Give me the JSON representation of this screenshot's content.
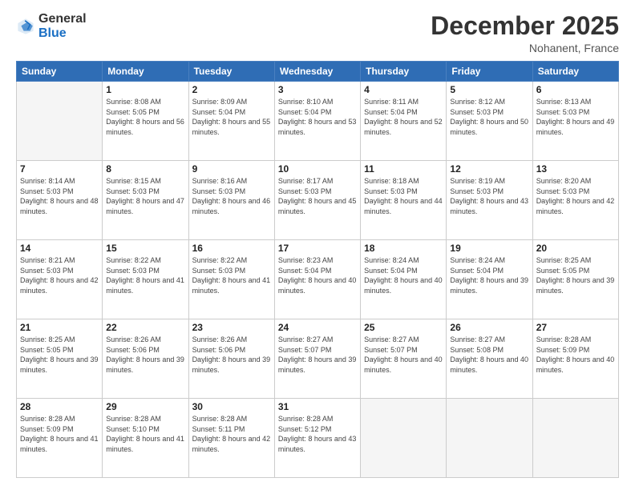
{
  "header": {
    "logo_general": "General",
    "logo_blue": "Blue",
    "month_title": "December 2025",
    "location": "Nohanent, France"
  },
  "days_of_week": [
    "Sunday",
    "Monday",
    "Tuesday",
    "Wednesday",
    "Thursday",
    "Friday",
    "Saturday"
  ],
  "weeks": [
    [
      {
        "day": "",
        "empty": true
      },
      {
        "day": "1",
        "sunrise": "Sunrise: 8:08 AM",
        "sunset": "Sunset: 5:05 PM",
        "daylight": "Daylight: 8 hours and 56 minutes."
      },
      {
        "day": "2",
        "sunrise": "Sunrise: 8:09 AM",
        "sunset": "Sunset: 5:04 PM",
        "daylight": "Daylight: 8 hours and 55 minutes."
      },
      {
        "day": "3",
        "sunrise": "Sunrise: 8:10 AM",
        "sunset": "Sunset: 5:04 PM",
        "daylight": "Daylight: 8 hours and 53 minutes."
      },
      {
        "day": "4",
        "sunrise": "Sunrise: 8:11 AM",
        "sunset": "Sunset: 5:04 PM",
        "daylight": "Daylight: 8 hours and 52 minutes."
      },
      {
        "day": "5",
        "sunrise": "Sunrise: 8:12 AM",
        "sunset": "Sunset: 5:03 PM",
        "daylight": "Daylight: 8 hours and 50 minutes."
      },
      {
        "day": "6",
        "sunrise": "Sunrise: 8:13 AM",
        "sunset": "Sunset: 5:03 PM",
        "daylight": "Daylight: 8 hours and 49 minutes."
      }
    ],
    [
      {
        "day": "7",
        "sunrise": "Sunrise: 8:14 AM",
        "sunset": "Sunset: 5:03 PM",
        "daylight": "Daylight: 8 hours and 48 minutes."
      },
      {
        "day": "8",
        "sunrise": "Sunrise: 8:15 AM",
        "sunset": "Sunset: 5:03 PM",
        "daylight": "Daylight: 8 hours and 47 minutes."
      },
      {
        "day": "9",
        "sunrise": "Sunrise: 8:16 AM",
        "sunset": "Sunset: 5:03 PM",
        "daylight": "Daylight: 8 hours and 46 minutes."
      },
      {
        "day": "10",
        "sunrise": "Sunrise: 8:17 AM",
        "sunset": "Sunset: 5:03 PM",
        "daylight": "Daylight: 8 hours and 45 minutes."
      },
      {
        "day": "11",
        "sunrise": "Sunrise: 8:18 AM",
        "sunset": "Sunset: 5:03 PM",
        "daylight": "Daylight: 8 hours and 44 minutes."
      },
      {
        "day": "12",
        "sunrise": "Sunrise: 8:19 AM",
        "sunset": "Sunset: 5:03 PM",
        "daylight": "Daylight: 8 hours and 43 minutes."
      },
      {
        "day": "13",
        "sunrise": "Sunrise: 8:20 AM",
        "sunset": "Sunset: 5:03 PM",
        "daylight": "Daylight: 8 hours and 42 minutes."
      }
    ],
    [
      {
        "day": "14",
        "sunrise": "Sunrise: 8:21 AM",
        "sunset": "Sunset: 5:03 PM",
        "daylight": "Daylight: 8 hours and 42 minutes."
      },
      {
        "day": "15",
        "sunrise": "Sunrise: 8:22 AM",
        "sunset": "Sunset: 5:03 PM",
        "daylight": "Daylight: 8 hours and 41 minutes."
      },
      {
        "day": "16",
        "sunrise": "Sunrise: 8:22 AM",
        "sunset": "Sunset: 5:03 PM",
        "daylight": "Daylight: 8 hours and 41 minutes."
      },
      {
        "day": "17",
        "sunrise": "Sunrise: 8:23 AM",
        "sunset": "Sunset: 5:04 PM",
        "daylight": "Daylight: 8 hours and 40 minutes."
      },
      {
        "day": "18",
        "sunrise": "Sunrise: 8:24 AM",
        "sunset": "Sunset: 5:04 PM",
        "daylight": "Daylight: 8 hours and 40 minutes."
      },
      {
        "day": "19",
        "sunrise": "Sunrise: 8:24 AM",
        "sunset": "Sunset: 5:04 PM",
        "daylight": "Daylight: 8 hours and 39 minutes."
      },
      {
        "day": "20",
        "sunrise": "Sunrise: 8:25 AM",
        "sunset": "Sunset: 5:05 PM",
        "daylight": "Daylight: 8 hours and 39 minutes."
      }
    ],
    [
      {
        "day": "21",
        "sunrise": "Sunrise: 8:25 AM",
        "sunset": "Sunset: 5:05 PM",
        "daylight": "Daylight: 8 hours and 39 minutes."
      },
      {
        "day": "22",
        "sunrise": "Sunrise: 8:26 AM",
        "sunset": "Sunset: 5:06 PM",
        "daylight": "Daylight: 8 hours and 39 minutes."
      },
      {
        "day": "23",
        "sunrise": "Sunrise: 8:26 AM",
        "sunset": "Sunset: 5:06 PM",
        "daylight": "Daylight: 8 hours and 39 minutes."
      },
      {
        "day": "24",
        "sunrise": "Sunrise: 8:27 AM",
        "sunset": "Sunset: 5:07 PM",
        "daylight": "Daylight: 8 hours and 39 minutes."
      },
      {
        "day": "25",
        "sunrise": "Sunrise: 8:27 AM",
        "sunset": "Sunset: 5:07 PM",
        "daylight": "Daylight: 8 hours and 40 minutes."
      },
      {
        "day": "26",
        "sunrise": "Sunrise: 8:27 AM",
        "sunset": "Sunset: 5:08 PM",
        "daylight": "Daylight: 8 hours and 40 minutes."
      },
      {
        "day": "27",
        "sunrise": "Sunrise: 8:28 AM",
        "sunset": "Sunset: 5:09 PM",
        "daylight": "Daylight: 8 hours and 40 minutes."
      }
    ],
    [
      {
        "day": "28",
        "sunrise": "Sunrise: 8:28 AM",
        "sunset": "Sunset: 5:09 PM",
        "daylight": "Daylight: 8 hours and 41 minutes."
      },
      {
        "day": "29",
        "sunrise": "Sunrise: 8:28 AM",
        "sunset": "Sunset: 5:10 PM",
        "daylight": "Daylight: 8 hours and 41 minutes."
      },
      {
        "day": "30",
        "sunrise": "Sunrise: 8:28 AM",
        "sunset": "Sunset: 5:11 PM",
        "daylight": "Daylight: 8 hours and 42 minutes."
      },
      {
        "day": "31",
        "sunrise": "Sunrise: 8:28 AM",
        "sunset": "Sunset: 5:12 PM",
        "daylight": "Daylight: 8 hours and 43 minutes."
      },
      {
        "day": "",
        "empty": true
      },
      {
        "day": "",
        "empty": true
      },
      {
        "day": "",
        "empty": true
      }
    ]
  ]
}
